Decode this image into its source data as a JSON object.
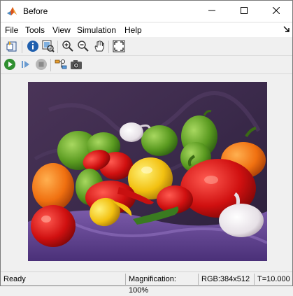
{
  "window": {
    "title": "Before",
    "title_icon": "matlab-logo-icon"
  },
  "menu": {
    "items": [
      "File",
      "Tools",
      "View",
      "Simulation",
      "Help"
    ],
    "pin_icon": "dock-arrow-icon"
  },
  "toolbar1": {
    "buttons": [
      "new-figure-icon",
      "info-icon",
      "image-info-icon",
      "zoom-in-icon",
      "zoom-out-icon",
      "pan-hand-icon",
      "fit-to-window-icon"
    ]
  },
  "toolbar2": {
    "buttons": [
      "run-icon",
      "step-forward-icon",
      "stop-icon",
      "configure-icon",
      "snapshot-icon"
    ]
  },
  "image": {
    "description_icon": "peppers-image"
  },
  "status": {
    "state": "Ready",
    "magnification": "Magnification: 100%",
    "rgb": "RGB:384x512",
    "time": "T=10.000"
  },
  "colors": {
    "title_bg": "#ffffff",
    "window_bg": "#f0f0f0",
    "run_green": "#2f8f2f",
    "info_blue": "#1f5fae"
  }
}
